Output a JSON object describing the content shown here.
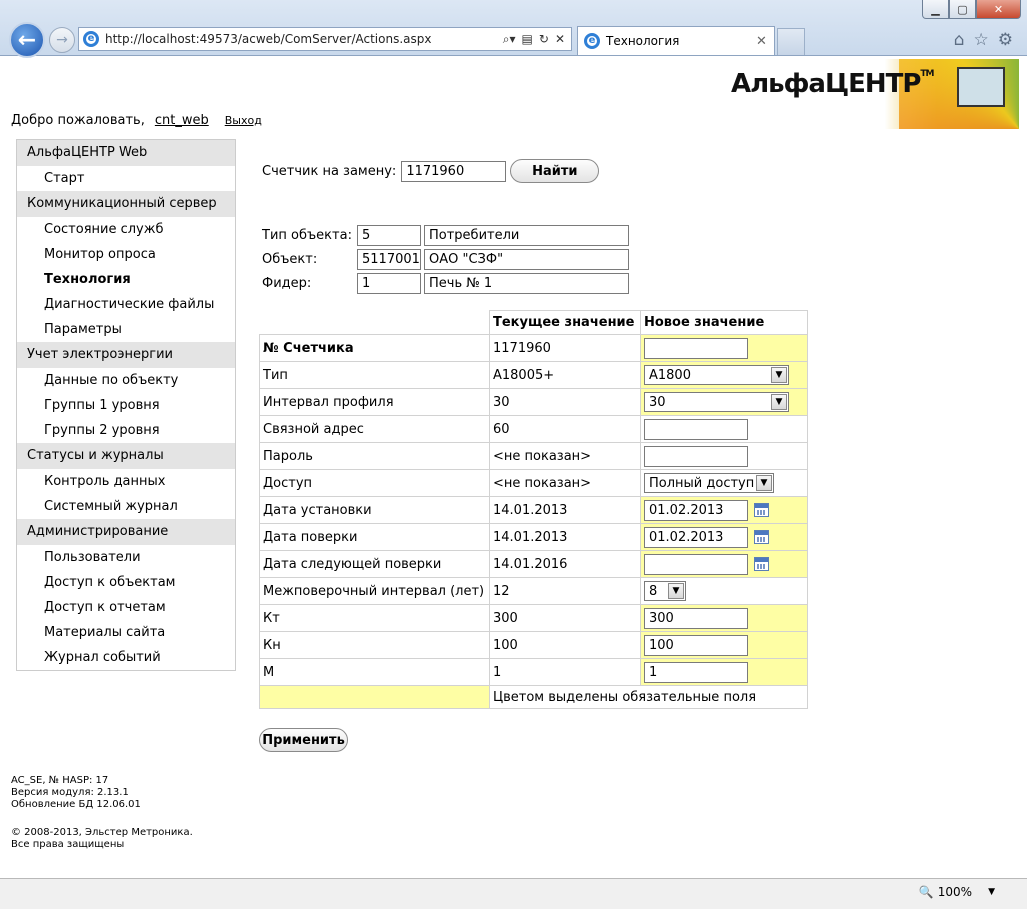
{
  "browser": {
    "url": "http://localhost:49573/acweb/ComServer/Actions.aspx",
    "tab_title": "Технология",
    "zoom": "100%"
  },
  "logo": {
    "text": "АльфаЦЕНТР",
    "tm": "TM"
  },
  "welcome": {
    "greeting": "Добро пожаловать,",
    "user": "cnt_web",
    "logout": "Выход"
  },
  "sidebar": [
    {
      "type": "header",
      "label": "АльфаЦЕНТР Web"
    },
    {
      "type": "item",
      "label": "Старт"
    },
    {
      "type": "header",
      "label": "Коммуникационный сервер"
    },
    {
      "type": "item",
      "label": "Состояние служб"
    },
    {
      "type": "item",
      "label": "Монитор опроса"
    },
    {
      "type": "item",
      "label": "Технология",
      "active": true
    },
    {
      "type": "item",
      "label": "Диагностические файлы"
    },
    {
      "type": "item",
      "label": "Параметры"
    },
    {
      "type": "header",
      "label": "Учет электроэнергии"
    },
    {
      "type": "item",
      "label": "Данные по объекту"
    },
    {
      "type": "item",
      "label": "Группы 1 уровня"
    },
    {
      "type": "item",
      "label": "Группы 2 уровня"
    },
    {
      "type": "header",
      "label": "Статусы и журналы"
    },
    {
      "type": "item",
      "label": "Контроль данных"
    },
    {
      "type": "item",
      "label": "Системный журнал"
    },
    {
      "type": "header",
      "label": "Администрирование"
    },
    {
      "type": "item",
      "label": "Пользователи"
    },
    {
      "type": "item",
      "label": "Доступ к объектам"
    },
    {
      "type": "item",
      "label": "Доступ к отчетам"
    },
    {
      "type": "item",
      "label": "Материалы сайта"
    },
    {
      "type": "item",
      "label": "Журнал событий"
    }
  ],
  "footer": {
    "line1": "AC_SE, № HASP: 17",
    "line2": "Версия модуля: 2.13.1",
    "line3": "Обновление БД 12.06.01",
    "line4": "© 2008-2013, Эльстер Метроника.",
    "line5": "Все права защищены"
  },
  "search": {
    "label": "Счетчик на замену:",
    "value": "1171960",
    "button": "Найти"
  },
  "object": {
    "type_label": "Тип объекта:",
    "type_code": "5",
    "type_name": "Потребители",
    "obj_label": "Объект:",
    "obj_code": "5117001",
    "obj_name": "ОАО \"СЗФ\"",
    "feeder_label": "Фидер:",
    "feeder_code": "1",
    "feeder_name": "Печь № 1"
  },
  "table": {
    "col_current": "Текущее значение",
    "col_new": "Новое значение",
    "rows": [
      {
        "label": "№ Счетчика",
        "bold": true,
        "current": "1171960",
        "kind": "input",
        "value": "",
        "required": true
      },
      {
        "label": "Тип",
        "current": "A18005+",
        "kind": "select",
        "value": "A1800",
        "required": true
      },
      {
        "label": "Интервал профиля",
        "current": "30",
        "kind": "select",
        "value": "30",
        "required": true
      },
      {
        "label": "Связной адрес",
        "current": "60",
        "kind": "input",
        "value": "",
        "required": false
      },
      {
        "label": "Пароль",
        "current": "<не показан>",
        "kind": "input",
        "value": "",
        "required": false
      },
      {
        "label": "Доступ",
        "current": "<не показан>",
        "kind": "select-short",
        "value": "Полный доступ",
        "required": false
      },
      {
        "label": "Дата установки",
        "current": "14.01.2013",
        "kind": "date",
        "value": "01.02.2013",
        "required": true
      },
      {
        "label": "Дата поверки",
        "current": "14.01.2013",
        "kind": "date",
        "value": "01.02.2013",
        "required": true
      },
      {
        "label": "Дата следующей поверки",
        "current": "14.01.2016",
        "kind": "date",
        "value": "",
        "required": true
      },
      {
        "label": "Межповерочный интервал (лет)",
        "current": "12",
        "kind": "select-tiny",
        "value": "8",
        "required": false
      },
      {
        "label": "Кт",
        "current": "300",
        "kind": "input",
        "value": "300",
        "required": true
      },
      {
        "label": "Кн",
        "current": "100",
        "kind": "input",
        "value": "100",
        "required": true
      },
      {
        "label": "M",
        "current": "1",
        "kind": "input",
        "value": "1",
        "required": true
      }
    ],
    "legend": "Цветом выделены обязательные поля"
  },
  "apply_button": "Применить",
  "colors": {
    "required_bg": "#fefea4",
    "sidebar_header_bg": "#e4e4e4"
  }
}
